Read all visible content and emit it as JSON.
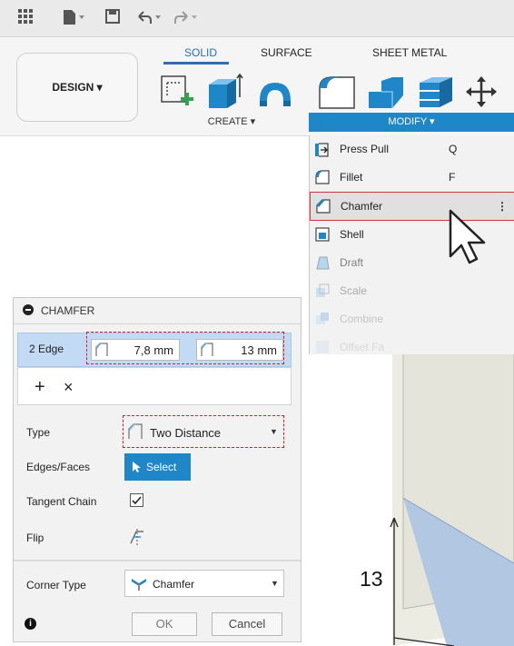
{
  "quick_access": {
    "icons": [
      "grid-icon",
      "file-icon",
      "save-icon",
      "undo-icon",
      "redo-icon"
    ]
  },
  "ribbon": {
    "workspace_button": "DESIGN ▾",
    "tabs": [
      {
        "label": "SOLID",
        "active": true
      },
      {
        "label": "SURFACE",
        "active": false
      },
      {
        "label": "SHEET METAL",
        "active": false
      }
    ],
    "create_label": "CREATE ▾",
    "modify_label": "MODIFY ▾",
    "accent_color": "#1f86c7"
  },
  "modify_menu": {
    "items": [
      {
        "label": "Press Pull",
        "shortcut": "Q",
        "icon": "press-pull-icon"
      },
      {
        "label": "Fillet",
        "shortcut": "F",
        "icon": "fillet-icon"
      },
      {
        "label": "Chamfer",
        "shortcut": "⋮",
        "icon": "chamfer-icon",
        "highlighted": true
      },
      {
        "label": "Shell",
        "shortcut": "",
        "icon": "shell-icon"
      },
      {
        "label": "Draft",
        "shortcut": "",
        "icon": "draft-icon"
      },
      {
        "label": "Scale",
        "shortcut": "",
        "icon": "scale-icon"
      },
      {
        "label": "Combine",
        "shortcut": "",
        "icon": "combine-icon"
      },
      {
        "label": "Offset Fa",
        "shortcut": "",
        "icon": "offset-face-icon"
      }
    ]
  },
  "chamfer_panel": {
    "title": "CHAMFER",
    "edge_count": "2",
    "edge_label": "Edge",
    "distance1": "7,8 mm",
    "distance2": "13 mm",
    "add_symbol": "+",
    "remove_symbol": "×",
    "type_label": "Type",
    "type_value": "Two Distance",
    "edges_faces_label": "Edges/Faces",
    "select_button": "Select",
    "tangent_chain_label": "Tangent Chain",
    "tangent_chain_checked": true,
    "flip_label": "Flip",
    "corner_type_label": "Corner Type",
    "corner_type_value": "Chamfer",
    "ok_button": "OK",
    "cancel_button": "Cancel"
  },
  "viewport": {
    "dimension_label": "13"
  }
}
